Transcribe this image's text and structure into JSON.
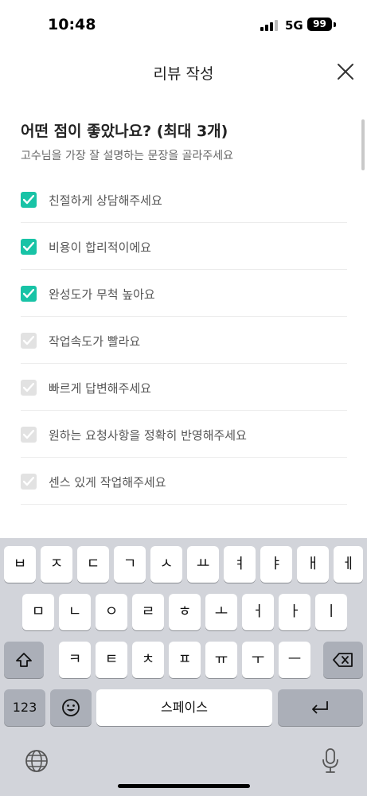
{
  "status_bar": {
    "time": "10:48",
    "network": "5G",
    "battery": "99"
  },
  "header": {
    "title": "리뷰 작성"
  },
  "question": {
    "title": "어떤 점이 좋았나요? (최대 3개)",
    "subtitle": "고수님을 가장 잘 설명하는 문장을 골라주세요"
  },
  "options": [
    {
      "label": "친절하게 상담해주세요",
      "checked": true
    },
    {
      "label": "비용이 합리적이에요",
      "checked": true
    },
    {
      "label": "완성도가 무척 높아요",
      "checked": true
    },
    {
      "label": "작업속도가 빨라요",
      "checked": false
    },
    {
      "label": "빠르게 답변해주세요",
      "checked": false
    },
    {
      "label": "원하는 요청사항을 정확히 반영해주세요",
      "checked": false
    },
    {
      "label": "센스 있게 작업해주세요",
      "checked": false
    }
  ],
  "keyboard": {
    "row1": [
      "ㅂ",
      "ㅈ",
      "ㄷ",
      "ㄱ",
      "ㅅ",
      "ㅛ",
      "ㅕ",
      "ㅑ",
      "ㅐ",
      "ㅔ"
    ],
    "row2": [
      "ㅁ",
      "ㄴ",
      "ㅇ",
      "ㄹ",
      "ㅎ",
      "ㅗ",
      "ㅓ",
      "ㅏ",
      "ㅣ"
    ],
    "row3": [
      "ㅋ",
      "ㅌ",
      "ㅊ",
      "ㅍ",
      "ㅠ",
      "ㅜ",
      "ㅡ"
    ],
    "numbers_label": "123",
    "space_label": "스페이스"
  },
  "colors": {
    "accent": "#18c3a6",
    "unchecked": "#e2e2e2",
    "keyboard_bg": "#d2d4da"
  }
}
